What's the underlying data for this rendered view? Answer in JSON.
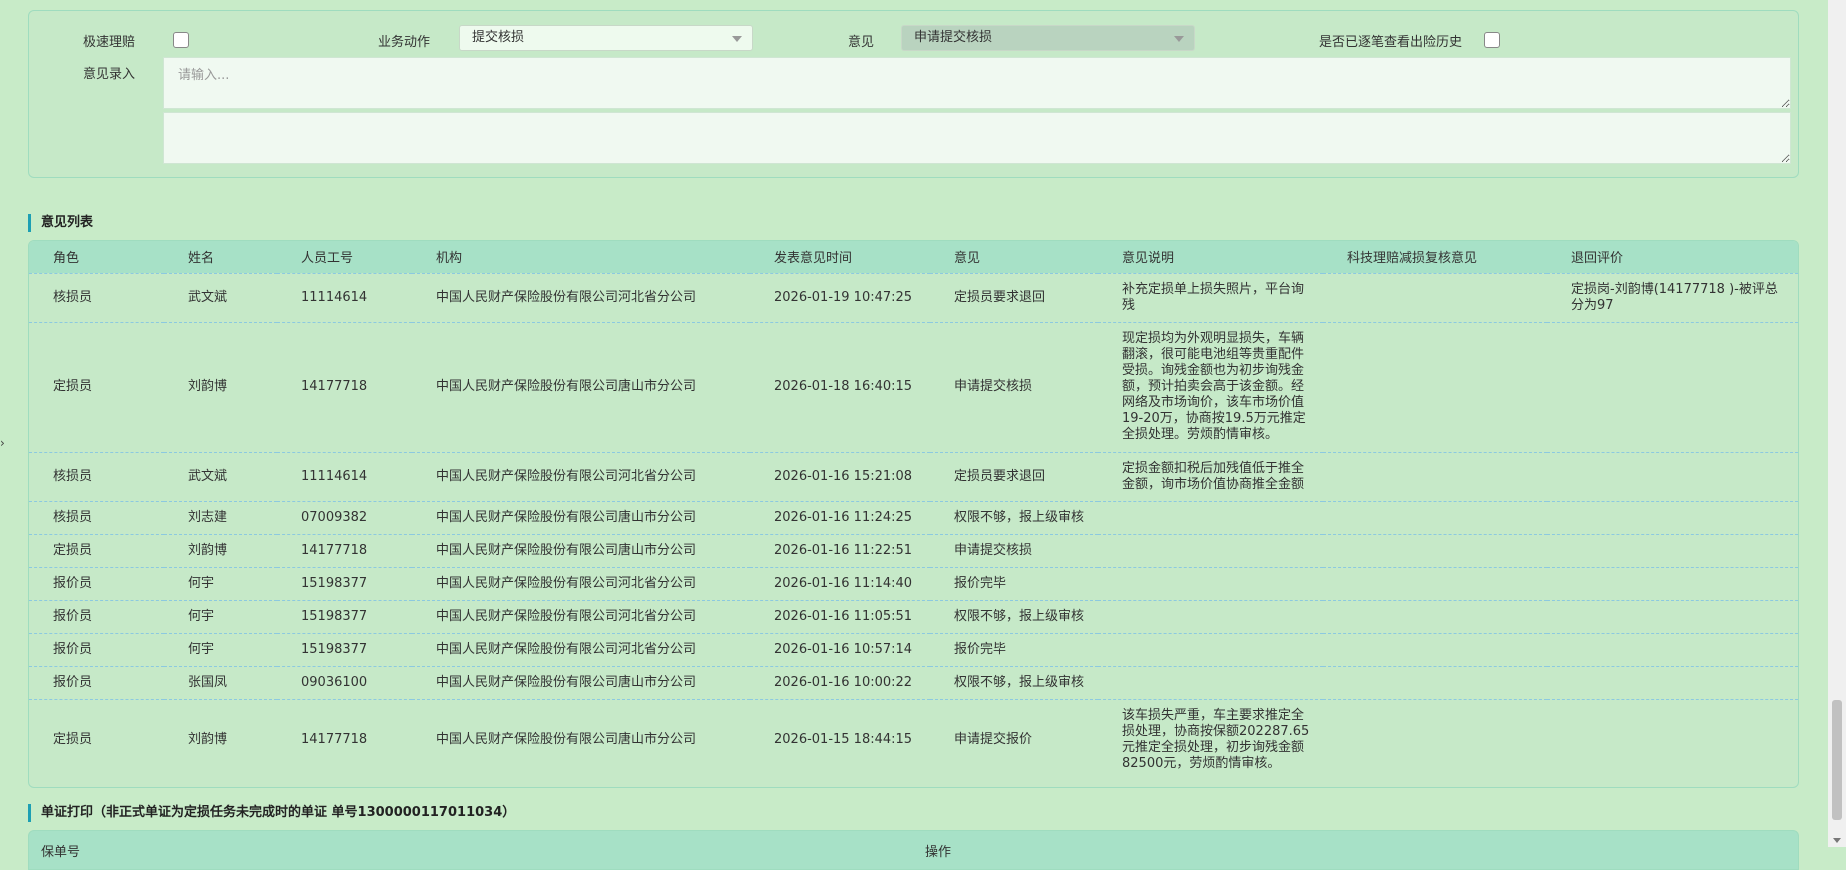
{
  "form": {
    "fast_claim_label": "极速理赔",
    "business_action_label": "业务动作",
    "business_action_value": "提交核损",
    "opinion_label": "意见",
    "opinion_value": "申请提交核损",
    "history_label": "是否已逐笔查看出险历史",
    "opinion_entry_label": "意见录入",
    "opinion_entry_placeholder": "请输入..."
  },
  "opinion_list": {
    "title": "意见列表",
    "columns": [
      "角色",
      "姓名",
      "人员工号",
      "机构",
      "发表意见时间",
      "意见",
      "意见说明",
      "科技理赔减损复核意见",
      "退回评价"
    ],
    "rows": [
      {
        "role": "核损员",
        "name": "武文斌",
        "id": "11114614",
        "org": "中国人民财产保险股份有限公司河北省分公司",
        "time": "2026-01-19 10:47:25",
        "opinion": "定损员要求退回",
        "desc": "补充定损单上损失照片，平台询残",
        "review": "",
        "return_eval": "定损岗-刘韵博(14177718 )-被评总分为97"
      },
      {
        "role": "定损员",
        "name": "刘韵博",
        "id": "14177718",
        "org": "中国人民财产保险股份有限公司唐山市分公司",
        "time": "2026-01-18 16:40:15",
        "opinion": "申请提交核损",
        "desc": "现定损均为外观明显损失，车辆翻滚，很可能电池组等贵重配件受损。询残金额也为初步询残金额，预计拍卖会高于该金额。经网络及市场询价，该车市场价值19-20万，协商按19.5万元推定全损处理。劳烦酌情审核。",
        "review": "",
        "return_eval": ""
      },
      {
        "role": "核损员",
        "name": "武文斌",
        "id": "11114614",
        "org": "中国人民财产保险股份有限公司河北省分公司",
        "time": "2026-01-16 15:21:08",
        "opinion": "定损员要求退回",
        "desc": "定损金额扣税后加残值低于推全金额，询市场价值协商推全金额",
        "review": "",
        "return_eval": ""
      },
      {
        "role": "核损员",
        "name": "刘志建",
        "id": "07009382",
        "org": "中国人民财产保险股份有限公司唐山市分公司",
        "time": "2026-01-16 11:24:25",
        "opinion": "权限不够，报上级审核",
        "desc": "",
        "review": "",
        "return_eval": ""
      },
      {
        "role": "定损员",
        "name": "刘韵博",
        "id": "14177718",
        "org": "中国人民财产保险股份有限公司唐山市分公司",
        "time": "2026-01-16 11:22:51",
        "opinion": "申请提交核损",
        "desc": "",
        "review": "",
        "return_eval": ""
      },
      {
        "role": "报价员",
        "name": "何宇",
        "id": "15198377",
        "org": "中国人民财产保险股份有限公司河北省分公司",
        "time": "2026-01-16 11:14:40",
        "opinion": "报价完毕",
        "desc": "",
        "review": "",
        "return_eval": ""
      },
      {
        "role": "报价员",
        "name": "何宇",
        "id": "15198377",
        "org": "中国人民财产保险股份有限公司河北省分公司",
        "time": "2026-01-16 11:05:51",
        "opinion": "权限不够，报上级审核",
        "desc": "",
        "review": "",
        "return_eval": ""
      },
      {
        "role": "报价员",
        "name": "何宇",
        "id": "15198377",
        "org": "中国人民财产保险股份有限公司河北省分公司",
        "time": "2026-01-16 10:57:14",
        "opinion": "报价完毕",
        "desc": "",
        "review": "",
        "return_eval": ""
      },
      {
        "role": "报价员",
        "name": "张国凤",
        "id": "09036100",
        "org": "中国人民财产保险股份有限公司唐山市分公司",
        "time": "2026-01-16 10:00:22",
        "opinion": "权限不够，报上级审核",
        "desc": "",
        "review": "",
        "return_eval": ""
      },
      {
        "role": "定损员",
        "name": "刘韵博",
        "id": "14177718",
        "org": "中国人民财产保险股份有限公司唐山市分公司",
        "time": "2026-01-15 18:44:15",
        "opinion": "申请提交报价",
        "desc": "该车损失严重，车主要求推定全损处理，协商按保额202287.65元推定全损处理，初步询残金额82500元，劳烦酌情审核。",
        "review": "",
        "return_eval": ""
      }
    ]
  },
  "print_section": {
    "title": "单证打印（非正式单证为定损任务未完成时的单证 单号1300000117011034）",
    "col1": "保单号",
    "col2": "操作"
  }
}
